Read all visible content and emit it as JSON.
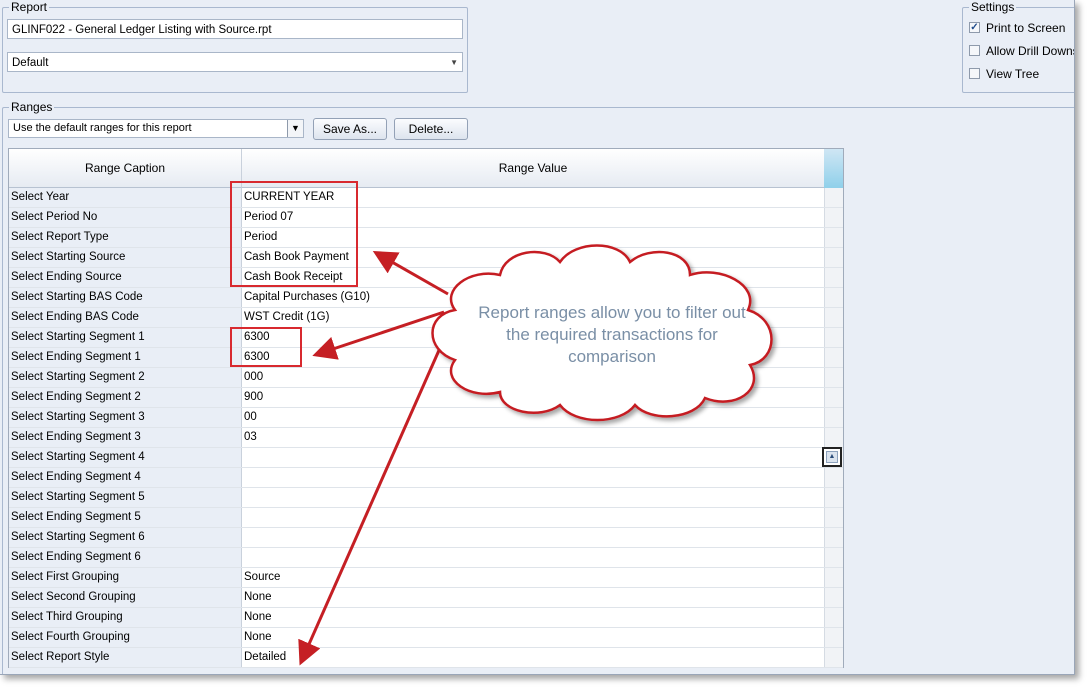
{
  "report": {
    "legend": "Report",
    "name": "GLINF022 - General Ledger Listing with Source.rpt",
    "layout": "Default"
  },
  "settings": {
    "legend": "Settings",
    "items": [
      {
        "label": "Print to Screen",
        "checked": true
      },
      {
        "label": "Allow Drill Downs",
        "checked": false
      },
      {
        "label": "View Tree",
        "checked": false
      }
    ]
  },
  "ranges": {
    "legend": "Ranges",
    "selection": "Use the default ranges for this report",
    "save_as": "Save As...",
    "delete": "Delete..."
  },
  "grid": {
    "headers": [
      "Range Caption",
      "Range Value"
    ],
    "rows": [
      {
        "caption": "Select Year",
        "value": "CURRENT YEAR"
      },
      {
        "caption": "Select Period No",
        "value": "Period 07"
      },
      {
        "caption": "Select Report Type",
        "value": "Period"
      },
      {
        "caption": "Select Starting Source",
        "value": "Cash Book Payment"
      },
      {
        "caption": "Select Ending Source",
        "value": "Cash Book Receipt"
      },
      {
        "caption": "Select Starting BAS Code",
        "value": "Capital Purchases (G10)"
      },
      {
        "caption": "Select Ending BAS Code",
        "value": "WST Credit (1G)"
      },
      {
        "caption": "Select Starting Segment 1",
        "value": "6300"
      },
      {
        "caption": "Select Ending Segment 1",
        "value": "6300"
      },
      {
        "caption": "Select Starting Segment 2",
        "value": "000"
      },
      {
        "caption": "Select Ending Segment 2",
        "value": "900"
      },
      {
        "caption": "Select Starting Segment 3",
        "value": "00"
      },
      {
        "caption": "Select Ending Segment 3",
        "value": "03"
      },
      {
        "caption": "Select Starting Segment 4",
        "value": ""
      },
      {
        "caption": "Select Ending Segment 4",
        "value": ""
      },
      {
        "caption": "Select Starting Segment 5",
        "value": ""
      },
      {
        "caption": "Select Ending Segment 5",
        "value": ""
      },
      {
        "caption": "Select Starting Segment 6",
        "value": ""
      },
      {
        "caption": "Select Ending Segment 6",
        "value": ""
      },
      {
        "caption": "Select First Grouping",
        "value": "Source"
      },
      {
        "caption": "Select Second Grouping",
        "value": "None"
      },
      {
        "caption": "Select Third Grouping",
        "value": "None"
      },
      {
        "caption": "Select Fourth Grouping",
        "value": "None"
      },
      {
        "caption": "Select Report Style",
        "value": "Detailed"
      }
    ]
  },
  "callout": {
    "text": "Report ranges allow you to filter out the required transactions for comparison"
  },
  "colors": {
    "highlight": "#d8292f",
    "callout_text": "#7a8fa6",
    "panel_bg": "#e9eef6"
  }
}
